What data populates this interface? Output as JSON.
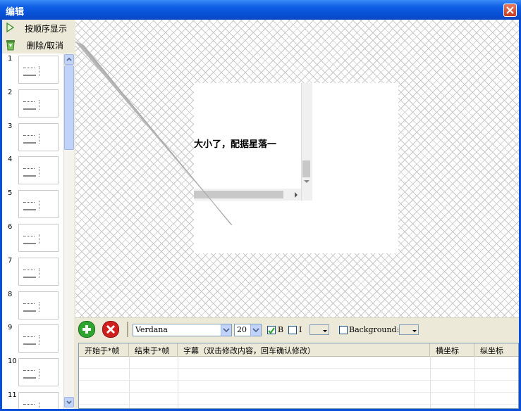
{
  "window": {
    "title": "编辑"
  },
  "toolbar": {
    "play_in_order_label": "按顺序显示",
    "delete_cancel_label": "删除/取消"
  },
  "thumbnails": [
    "1",
    "2",
    "3",
    "4",
    "5",
    "6",
    "7",
    "8",
    "9",
    "10",
    "11"
  ],
  "stage": {
    "subtitle_text": "大小了，配据星落一"
  },
  "controls": {
    "font_value": "Verdana",
    "size_value": "20",
    "bold_label": "B",
    "bold_checked": true,
    "italic_label": "I",
    "italic_checked": false,
    "background_label": "Background:",
    "background_checked": false
  },
  "grid": {
    "columns": [
      "开始于*帧",
      "结束于*帧",
      "字幕（双击修改内容，回车确认修改）",
      "横坐标",
      "纵坐标"
    ]
  },
  "colors": {
    "titlebar": "#0a4fd8",
    "add_button": "#2fa52f",
    "delete_button": "#d01f1f",
    "stage_pattern": "#c9c9c9"
  }
}
